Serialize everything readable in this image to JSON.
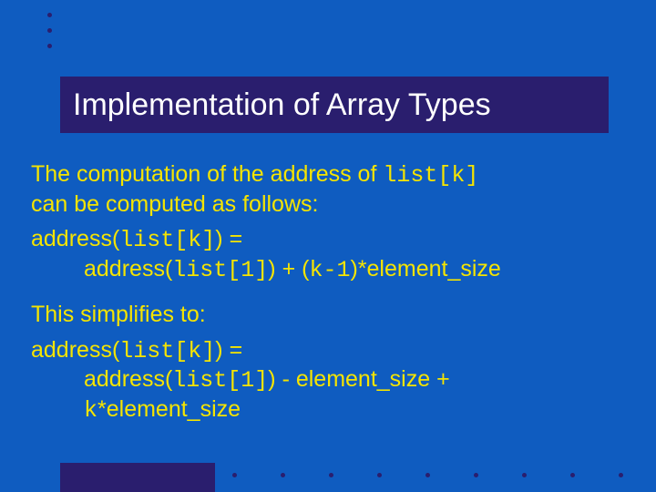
{
  "title": "Implementation of Array Types",
  "intro": {
    "line1_pre": "The computation of the address of ",
    "line1_code": "list[k]",
    "line2": "can be computed as follows:"
  },
  "formula1": {
    "lhs_pre": "address(",
    "lhs_code": "list[k]",
    "lhs_post": ") =",
    "rhs_pre": "address(",
    "rhs_code1": "list[1]",
    "rhs_mid": ") + (",
    "rhs_code2": "k-1",
    "rhs_post": ")*element_size"
  },
  "simplifies": "This simplifies to:",
  "formula2": {
    "lhs_pre": "address(",
    "lhs_code": "list[k]",
    "lhs_post": ") =",
    "rhs_pre": "address(",
    "rhs_code1": "list[1]",
    "rhs_mid": ") - element_size +",
    "rhs2_code": "k",
    "rhs2_post": "*element_size"
  }
}
